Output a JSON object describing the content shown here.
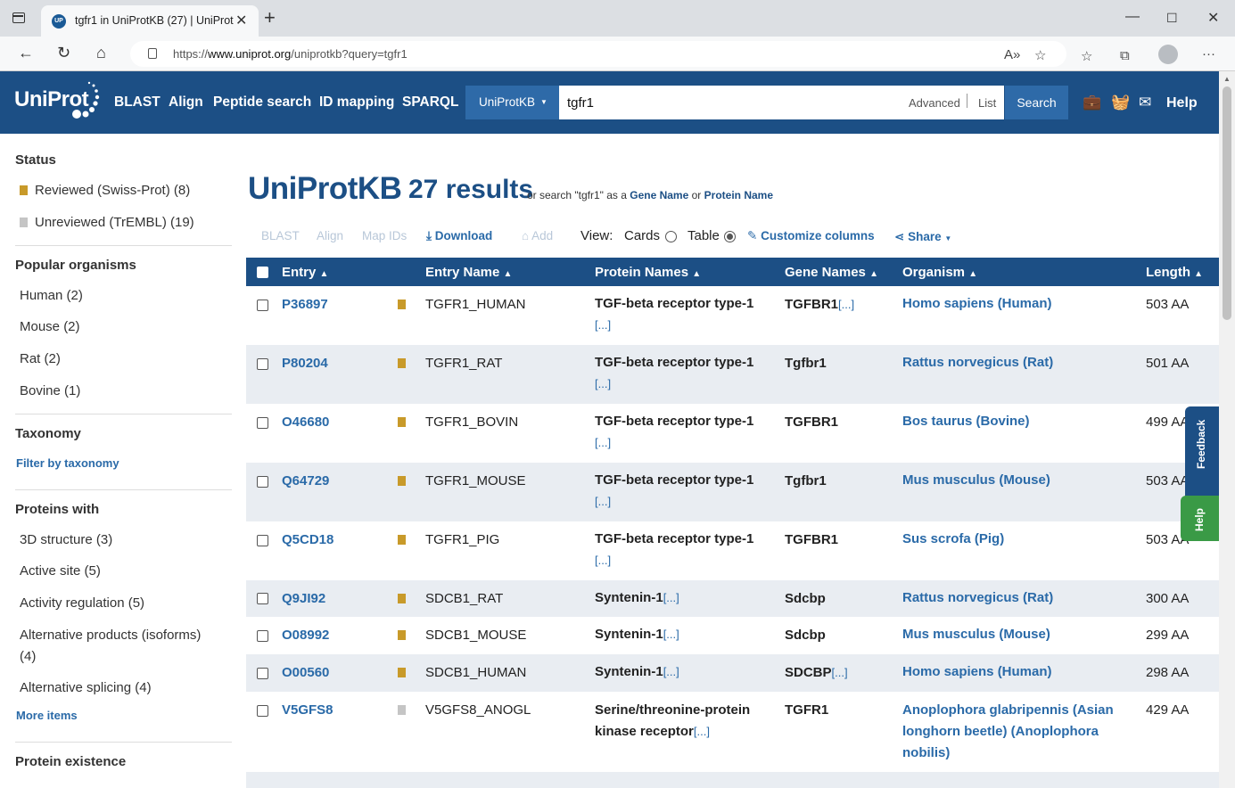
{
  "browser": {
    "tab_title": "tgfr1 in UniProtKB (27) | UniProt",
    "url_prefix": "https://",
    "url_host": "www.uniprot.org",
    "url_path": "/uniprotkb?query=tgfr1"
  },
  "header": {
    "logo": "UniProt",
    "nav": [
      "BLAST",
      "Align",
      "Peptide search",
      "ID mapping",
      "SPARQL"
    ],
    "db_select": "UniProtKB",
    "query": "tgfr1",
    "advanced": "Advanced",
    "list": "List",
    "search": "Search",
    "help": "Help"
  },
  "sidebar": {
    "status_heading": "Status",
    "reviewed": "Reviewed (Swiss-Prot) (8)",
    "unreviewed": "Unreviewed (TrEMBL) (19)",
    "organisms_heading": "Popular organisms",
    "organisms": [
      "Human (2)",
      "Mouse (2)",
      "Rat (2)",
      "Bovine (1)"
    ],
    "taxonomy_heading": "Taxonomy",
    "taxonomy_link": "Filter by taxonomy",
    "proteins_heading": "Proteins with",
    "proteins": [
      "3D structure (3)",
      "Active site (5)",
      "Activity regulation (5)",
      "Alternative products (isoforms)",
      "(4)",
      "Alternative splicing (4)"
    ],
    "more_items": "More items",
    "existence_heading": "Protein existence"
  },
  "main": {
    "title": "UniProtKB",
    "count": "27 results",
    "or_search_prefix": "or search \"tgfr1\" as a",
    "gene_name": "Gene Name",
    "or": "or",
    "protein_name": "Protein Name",
    "toolbar": {
      "blast": "BLAST",
      "align": "Align",
      "map_ids": "Map IDs",
      "download": "Download",
      "add": "Add",
      "view": "View:",
      "cards": "Cards",
      "table": "Table",
      "customize": "Customize columns",
      "share": "Share"
    },
    "columns": [
      "Entry",
      "Entry Name",
      "Protein Names",
      "Gene Names",
      "Organism",
      "Length"
    ],
    "more_marker": "[...]",
    "rows": [
      {
        "entry": "P36897",
        "name": "TGFR1_HUMAN",
        "protein": "TGF-beta receptor type-1",
        "gene": "TGFBR1",
        "organism": "Homo sapiens (Human)",
        "length": "503 AA"
      },
      {
        "entry": "P80204",
        "name": "TGFR1_RAT",
        "protein": "TGF-beta receptor type-1",
        "gene": "Tgfbr1",
        "organism": "Rattus norvegicus (Rat)",
        "length": "501 AA"
      },
      {
        "entry": "O46680",
        "name": "TGFR1_BOVIN",
        "protein": "TGF-beta receptor type-1",
        "gene": "TGFBR1",
        "organism": "Bos taurus (Bovine)",
        "length": "499 AA"
      },
      {
        "entry": "Q64729",
        "name": "TGFR1_MOUSE",
        "protein": "TGF-beta receptor type-1",
        "gene": "Tgfbr1",
        "organism": "Mus musculus (Mouse)",
        "length": "503 AA"
      },
      {
        "entry": "Q5CD18",
        "name": "TGFR1_PIG",
        "protein": "TGF-beta receptor type-1",
        "gene": "TGFBR1",
        "organism": "Sus scrofa (Pig)",
        "length": "503 AA"
      },
      {
        "entry": "Q9JI92",
        "name": "SDCB1_RAT",
        "protein": "Syntenin-1",
        "gene": "Sdcbp",
        "organism": "Rattus norvegicus (Rat)",
        "length": "300 AA"
      },
      {
        "entry": "O08992",
        "name": "SDCB1_MOUSE",
        "protein": "Syntenin-1",
        "gene": "Sdcbp",
        "organism": "Mus musculus (Mouse)",
        "length": "299 AA"
      },
      {
        "entry": "O00560",
        "name": "SDCB1_HUMAN",
        "protein": "Syntenin-1",
        "gene": "SDCBP",
        "organism": "Homo sapiens (Human)",
        "length": "298 AA"
      },
      {
        "entry": "V5GFS8",
        "name": "V5GFS8_ANOGL",
        "protein_l1": "Serine/threonine-protein",
        "protein_l2": "kinase receptor",
        "gene": "TGFR1",
        "org_l1": "Anoplophora glabripennis (Asian",
        "org_l2": "longhorn beetle) (Anoplophora",
        "org_l3": "nobilis)",
        "length": "429 AA"
      }
    ]
  },
  "feedback": "Feedback",
  "help_tab": "Help"
}
